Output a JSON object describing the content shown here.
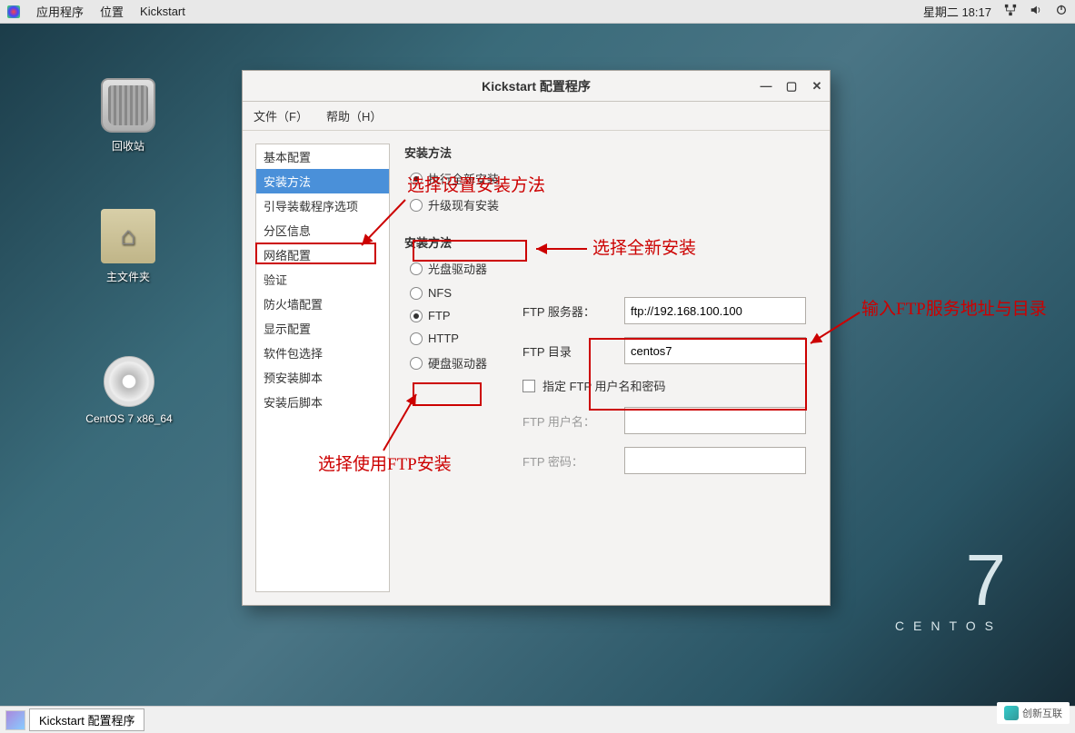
{
  "topbar": {
    "menu_apps": "应用程序",
    "menu_places": "位置",
    "menu_kickstart": "Kickstart",
    "clock": "星期二 18:17"
  },
  "desktop": {
    "trash": "回收站",
    "home": "主文件夹",
    "cd": "CentOS 7 x86_64"
  },
  "centos": {
    "seven": "7",
    "brand": "CENTOS"
  },
  "taskbar": {
    "task1": "Kickstart 配置程序"
  },
  "window": {
    "title": "Kickstart 配置程序",
    "menu_file": "文件（F）",
    "menu_help": "帮助（H）",
    "sidebar": {
      "items": [
        "基本配置",
        "安装方法",
        "引导装载程序选项",
        "分区信息",
        "网络配置",
        "验证",
        "防火墙配置",
        "显示配置",
        "软件包选择",
        "预安装脚本",
        "安装后脚本"
      ],
      "selected": 1
    },
    "panel": {
      "section1": "安装方法",
      "r_new": "执行全新安装",
      "r_upgrade": "升级现有安装",
      "section2": "安装方法",
      "r_cd": "光盘驱动器",
      "r_nfs": "NFS",
      "r_ftp": "FTP",
      "r_http": "HTTP",
      "r_hd": "硬盘驱动器",
      "lbl_server": "FTP 服务器：",
      "val_server": "ftp://192.168.100.100",
      "lbl_dir": "FTP 目录",
      "val_dir": "centos7",
      "chk_auth": "指定  FTP 用户名和密码",
      "lbl_user": "FTP 用户名：",
      "lbl_pass": "FTP 密码："
    }
  },
  "annotations": {
    "a1": "选择设置安装方法",
    "a2": "选择全新安装",
    "a3": "输入FTP服务地址与目录",
    "a4": "选择使用FTP安装"
  },
  "watermark": "创新互联"
}
